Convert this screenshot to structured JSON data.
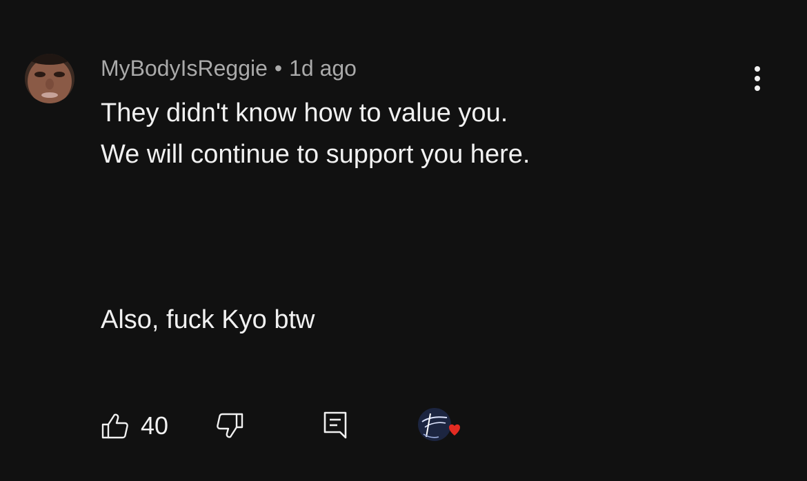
{
  "comment": {
    "author": "MyBodyIsReggie",
    "separator": "•",
    "time_ago": "1d ago",
    "lines": [
      "They didn't know how to value you.",
      "We will continue to support you here.",
      "Also, fuck Kyo btw"
    ],
    "like_count": "40"
  },
  "icons": {
    "more": "more-vertical-icon",
    "like": "thumbs-up-icon",
    "dislike": "thumbs-down-icon",
    "reply": "reply-comment-icon",
    "creator_heart": "creator-heart-icon"
  },
  "colors": {
    "background": "#111111",
    "text": "#f1f1f1",
    "secondary_text": "#aaaaaa",
    "heart": "#e32b22"
  }
}
